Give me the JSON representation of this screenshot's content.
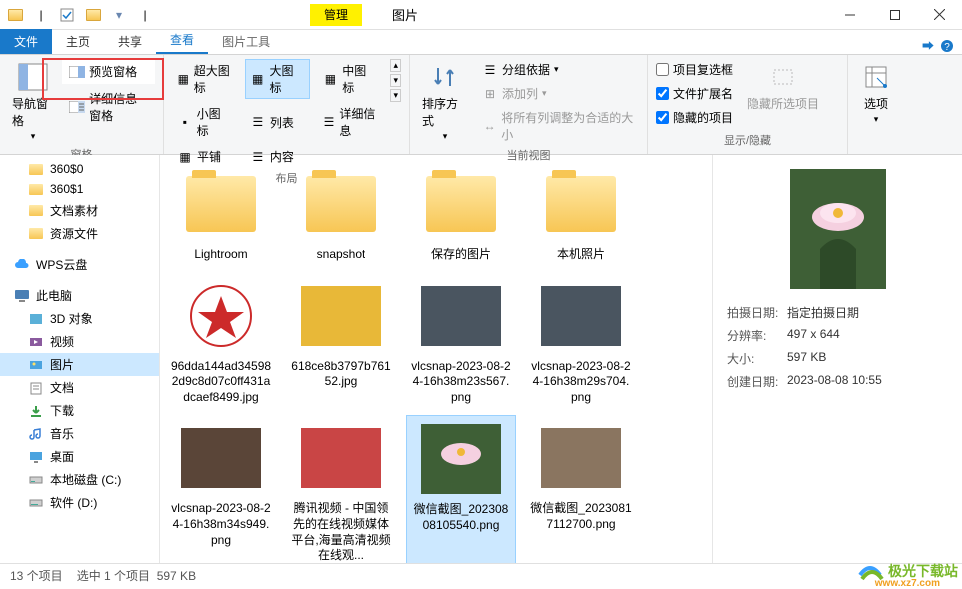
{
  "window": {
    "manage": "管理",
    "title": "图片"
  },
  "tabs": {
    "file": "文件",
    "home": "主页",
    "share": "共享",
    "view": "查看",
    "pic_tools": "图片工具"
  },
  "ribbon": {
    "nav": {
      "btn": "导航窗格",
      "group": "窗格"
    },
    "panes": {
      "preview": "预览窗格",
      "details": "详细信息窗格"
    },
    "layout": {
      "xl": "超大图标",
      "l": "大图标",
      "m": "中图标",
      "s": "小图标",
      "list": "列表",
      "detail": "详细信息",
      "tile": "平铺",
      "content": "内容",
      "group": "布局"
    },
    "curview": {
      "sort": "排序方式",
      "groupby": "分组依据",
      "addcol": "添加列",
      "autosize": "将所有列调整为合适的大小",
      "group": "当前视图"
    },
    "show": {
      "chk1": "项目复选框",
      "chk2": "文件扩展名",
      "chk3": "隐藏的项目",
      "hide": "隐藏所选项目",
      "group": "显示/隐藏"
    },
    "options": "选项"
  },
  "sidebar": {
    "items": [
      {
        "label": "360$0",
        "icon": "folder"
      },
      {
        "label": "360$1",
        "icon": "folder"
      },
      {
        "label": "文档素材",
        "icon": "folder"
      },
      {
        "label": "资源文件",
        "icon": "folder"
      }
    ],
    "wps": "WPS云盘",
    "pc": "此电脑",
    "pc_items": [
      {
        "label": "3D 对象"
      },
      {
        "label": "视频"
      },
      {
        "label": "图片"
      },
      {
        "label": "文档"
      },
      {
        "label": "下载"
      },
      {
        "label": "音乐"
      },
      {
        "label": "桌面"
      },
      {
        "label": "本地磁盘 (C:)"
      },
      {
        "label": "软件 (D:)"
      }
    ]
  },
  "files": [
    {
      "name": "Lightroom",
      "type": "folder"
    },
    {
      "name": "snapshot",
      "type": "folder"
    },
    {
      "name": "保存的图片",
      "type": "folder"
    },
    {
      "name": "本机照片",
      "type": "folder"
    },
    {
      "name": "96dda144ad345982d9c8d07c0ff431adcaef8499.jpg",
      "type": "img",
      "bg": "#fff"
    },
    {
      "name": "618ce8b3797b76152.jpg",
      "type": "img",
      "bg": "#e8b838"
    },
    {
      "name": "vlcsnap-2023-08-24-16h38m23s567.png",
      "type": "img",
      "bg": "#4a5560"
    },
    {
      "name": "vlcsnap-2023-08-24-16h38m29s704.png",
      "type": "img",
      "bg": "#4a5560"
    },
    {
      "name": "vlcsnap-2023-08-24-16h38m34s949.png",
      "type": "img",
      "bg": "#5a4538"
    },
    {
      "name": "腾讯视频 - 中国领先的在线视频媒体平台,海量高清视频在线观...",
      "type": "img",
      "bg": "#c94545"
    },
    {
      "name": "微信截图_20230808105540.png",
      "type": "img",
      "bg": "#4a6b3f",
      "selected": true
    },
    {
      "name": "微信截图_20230817112700.png",
      "type": "img",
      "bg": "#8a7560"
    }
  ],
  "preview": {
    "meta": [
      {
        "label": "拍摄日期:",
        "val": "指定拍摄日期"
      },
      {
        "label": "分辨率:",
        "val": "497 x 644"
      },
      {
        "label": "大小:",
        "val": "597 KB"
      },
      {
        "label": "创建日期:",
        "val": "2023-08-08 10:55"
      }
    ]
  },
  "status": {
    "count": "13 个项目",
    "sel": "选中 1 个项目",
    "size": "597 KB"
  },
  "watermark": {
    "main": "极光下载站",
    "sub": "www.xz7.com"
  }
}
